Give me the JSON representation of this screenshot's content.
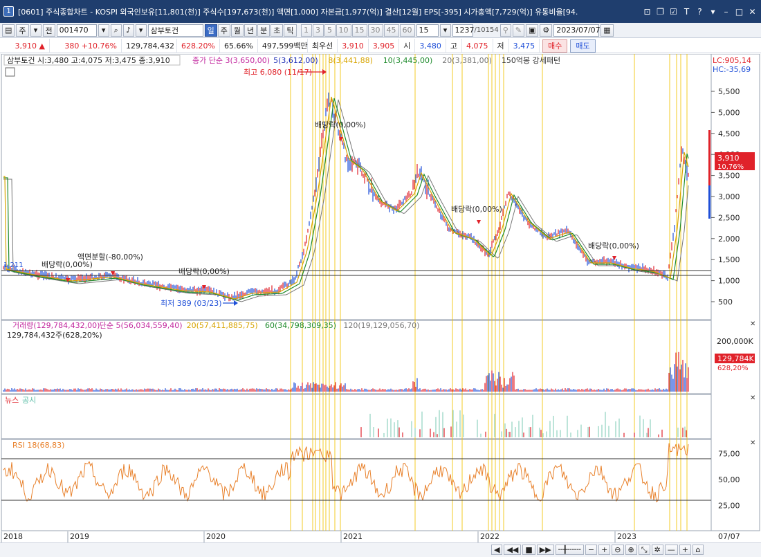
{
  "window": {
    "title": "[0601] 주식종합차트 - KOSPI 외국인보유[11,801(천)] 주식수[197,673(천)] 액면[1,000] 자본금[1,977(억)] 결산[12월] EPS[-395] 시가총액[7,729(억)] 유통비율[94.",
    "badge": "1"
  },
  "toolbar": {
    "type_btn": "주",
    "prev_btn": "전",
    "code": "001470",
    "name": "삼부토건",
    "period_buttons": [
      "일",
      "주",
      "월",
      "년",
      "분",
      "초",
      "틱"
    ],
    "active_period": "일",
    "intervals": [
      "1",
      "3",
      "5",
      "10",
      "15",
      "30",
      "45",
      "60"
    ],
    "interval_input": "15",
    "count": "1237",
    "total": "/10154",
    "date": "2023/07/07"
  },
  "quote": {
    "price": "3,910",
    "arrow": "▲",
    "change": "380",
    "change_pct": "+10.76%",
    "volume": "129,784,432",
    "volume_pct": "628.20%",
    "ratio": "65.66%",
    "amount": "497,599백만",
    "best_ask_label": "최우선",
    "best_ask": "3,910",
    "best_bid": "3,905",
    "open_label": "시",
    "open": "3,480",
    "high_label": "고",
    "high": "4,075",
    "low_label": "저",
    "low": "3,475",
    "buy": "매수",
    "sell": "매도"
  },
  "price_panel": {
    "info": "삼부토건 시:3,480 고:4,075 저:3,475 종:3,910",
    "ma_legend": [
      {
        "text": "종가 단순 3(3,650,00)",
        "color": "#c2279e"
      },
      {
        "text": "5(3,612,00)",
        "color": "#1b2bb5"
      },
      {
        "text": "8(3,441,88)",
        "color": "#d7a400"
      },
      {
        "text": "10(3,445,00)",
        "color": "#1e8b2c"
      },
      {
        "text": "20(3,381,00)",
        "color": "#777777"
      },
      {
        "text": "150억봉 강세패턴",
        "color": "#333333"
      }
    ],
    "lc": "LC:905,14",
    "hc": "HC:-35,69",
    "max_label": "최고 6,080 (11/17)",
    "min_label": "최저 389 (03/23)",
    "left_mark": "1,211",
    "split_label": "액면분할(-80,00%)",
    "dividend_labels": [
      "배당락(0,00%)",
      "배당락(0,00%)",
      "배당락(0,00%)",
      "배당락(0,00%)",
      "배당락(0,00%)"
    ],
    "y_ticks": [
      "5,500",
      "5,000",
      "4,500",
      "4,000",
      "3,500",
      "3,000",
      "2,500",
      "2,000",
      "1,500",
      "1,000",
      "500"
    ],
    "price_tag": "3,910",
    "price_tag_pct": "10,76%"
  },
  "volume_panel": {
    "legend": [
      {
        "text": "거래량(129,784,432,00)",
        "color": "#c2279e"
      },
      {
        "text": "단순 5(56,034,559,40)",
        "color": "#c2279e"
      },
      {
        "text": "20(57,411,885,75)",
        "color": "#d7a400"
      },
      {
        "text": "60(34,798,309,35)",
        "color": "#1e8b2c"
      },
      {
        "text": "120(19,129,056,70)",
        "color": "#777777"
      }
    ],
    "sub": "129,784,432주(628,20%)",
    "y_tick": "200,000K",
    "tag": "129,784K",
    "tag_pct": "628,20%"
  },
  "news_panel": {
    "news": "뉴스",
    "disclosure": "공시"
  },
  "rsi_panel": {
    "legend": "RSI 18(68,83)",
    "y_ticks": [
      "75,00",
      "50,00",
      "25,00"
    ]
  },
  "x_axis": {
    "labels": [
      "2018",
      "2019",
      "2020",
      "2021",
      "2022",
      "2023"
    ],
    "end_date": "07/07"
  },
  "colors": {
    "up": "#e0222a",
    "down": "#1f4fd8",
    "rsi": "#e8802a",
    "event_line": "#f2c200",
    "title_bg": "#1f3e6e"
  }
}
